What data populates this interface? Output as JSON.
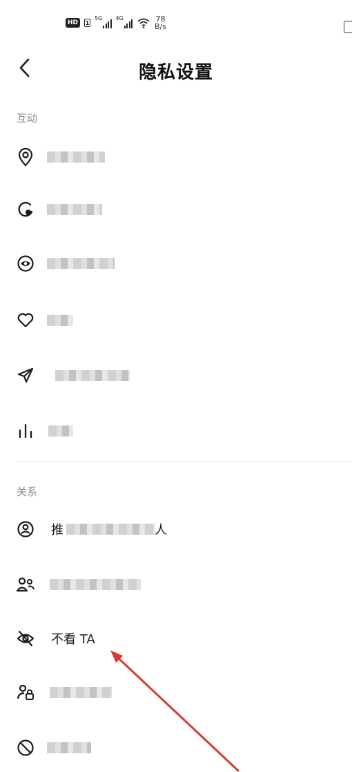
{
  "status_bar": {
    "hd_label": "HD",
    "sim_label": "1",
    "network1": "5G",
    "network2": "4G",
    "speed_value": "78",
    "speed_unit": "B/s"
  },
  "header": {
    "back_icon": "chevron-left-icon",
    "title": "隐私设置"
  },
  "sections": {
    "interaction": {
      "label": "互动",
      "items": [
        {
          "icon": "location-pin-icon",
          "label": ""
        },
        {
          "icon": "refresh-circle-icon",
          "label": ""
        },
        {
          "icon": "eye-circle-icon",
          "label": ""
        },
        {
          "icon": "heart-icon",
          "label": ""
        },
        {
          "icon": "send-icon",
          "label": ""
        },
        {
          "icon": "bar-chart-icon",
          "label": ""
        }
      ]
    },
    "relationship": {
      "label": "关系",
      "items": [
        {
          "icon": "user-circle-icon",
          "label_start": "推",
          "label_end": "人"
        },
        {
          "icon": "users-icon",
          "label": ""
        },
        {
          "icon": "eye-off-icon",
          "label": "不看 TA"
        },
        {
          "icon": "user-lock-icon",
          "label": ""
        },
        {
          "icon": "block-icon",
          "label": ""
        }
      ]
    }
  },
  "annotation": {
    "type": "red-arrow",
    "color": "#d93a2b",
    "target": "不看 TA"
  }
}
